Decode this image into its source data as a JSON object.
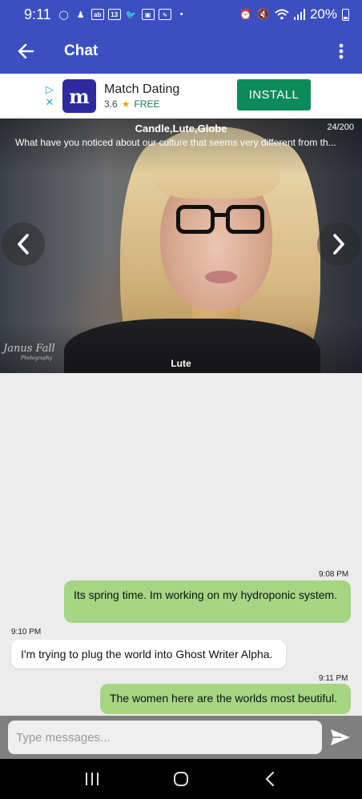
{
  "status_bar": {
    "time": "9:11",
    "battery": "20%",
    "notification_badges": [
      "13"
    ]
  },
  "app_bar": {
    "title": "Chat"
  },
  "ad": {
    "app_name": "Match Dating",
    "rating": "3.6",
    "price": "FREE",
    "install_label": "INSTALL",
    "logo_letter": "m"
  },
  "prompt_card": {
    "words": "Candle,Lute,Globe",
    "counter": "24/200",
    "question": "What have you noticed about our culture that seems very different from  th...",
    "caption": "Lute",
    "watermark": "Janus Fall",
    "watermark_sub": "Photography"
  },
  "messages": [
    {
      "side": "me",
      "time": "9:08 PM",
      "text": "Its spring time.  Im working on my hydroponic system."
    },
    {
      "side": "them",
      "time": "9:10 PM",
      "text": "I'm trying to plug the world into Ghost Writer Alpha."
    },
    {
      "side": "me",
      "time": "9:11 PM",
      "text": "The women here are the worlds most beutiful."
    }
  ],
  "composer": {
    "placeholder": "Type messages..."
  },
  "colors": {
    "primary": "#3b4fc1",
    "my_bubble": "#a6d584",
    "install": "#0d8a5a"
  }
}
